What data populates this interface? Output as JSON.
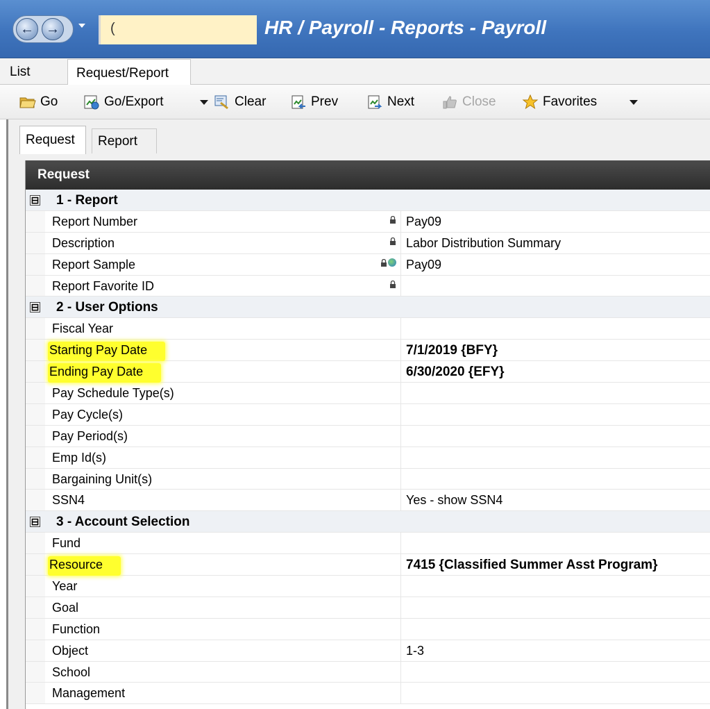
{
  "window": {
    "title": "HR / Payroll - Reports - Payroll",
    "address_value": "("
  },
  "outer_tabs": [
    "List",
    "Request/Report"
  ],
  "toolbar": {
    "go": "Go",
    "go_export": "Go/Export",
    "clear": "Clear",
    "prev": "Prev",
    "next": "Next",
    "close": "Close",
    "favorites": "Favorites"
  },
  "inner_tabs": [
    "Request",
    "Report"
  ],
  "grid": {
    "header": "Request",
    "sections": [
      {
        "title": "1 - Report",
        "expander": "⊟",
        "rows": [
          {
            "label": "Report Number",
            "value": "Pay09",
            "locked": true
          },
          {
            "label": "Description",
            "value": "Labor Distribution Summary",
            "locked": true
          },
          {
            "label": "Report Sample",
            "value": "Pay09",
            "locked": true,
            "globe": true
          },
          {
            "label": "Report Favorite ID",
            "value": "",
            "locked": true
          }
        ]
      },
      {
        "title": "2 - User Options",
        "expander": "⊟",
        "rows": [
          {
            "label": "Fiscal Year",
            "value": ""
          },
          {
            "label": "Starting Pay Date",
            "value": "7/1/2019 {BFY}",
            "bold": true,
            "highlight": true
          },
          {
            "label": "Ending Pay Date",
            "value": "6/30/2020 {EFY}",
            "bold": true,
            "highlight": true
          },
          {
            "label": "Pay Schedule Type(s)",
            "value": ""
          },
          {
            "label": "Pay Cycle(s)",
            "value": ""
          },
          {
            "label": "Pay Period(s)",
            "value": ""
          },
          {
            "label": "Emp Id(s)",
            "value": ""
          },
          {
            "label": "Bargaining Unit(s)",
            "value": ""
          },
          {
            "label": "SSN4",
            "value": "Yes - show SSN4"
          }
        ]
      },
      {
        "title": "3 - Account Selection",
        "expander": "⊟",
        "rows": [
          {
            "label": "Fund",
            "value": ""
          },
          {
            "label": "Resource",
            "value": "7415 {Classified Summer Asst Program}",
            "bold": true,
            "highlight": true
          },
          {
            "label": "Year",
            "value": ""
          },
          {
            "label": "Goal",
            "value": ""
          },
          {
            "label": "Function",
            "value": ""
          },
          {
            "label": "Object",
            "value": "1-3"
          },
          {
            "label": "School",
            "value": ""
          },
          {
            "label": "Management",
            "value": ""
          }
        ]
      }
    ]
  },
  "colors": {
    "titlebar": "#3f74bd",
    "grid_header": "#2d2d2d",
    "highlight": "#ffff2e"
  }
}
